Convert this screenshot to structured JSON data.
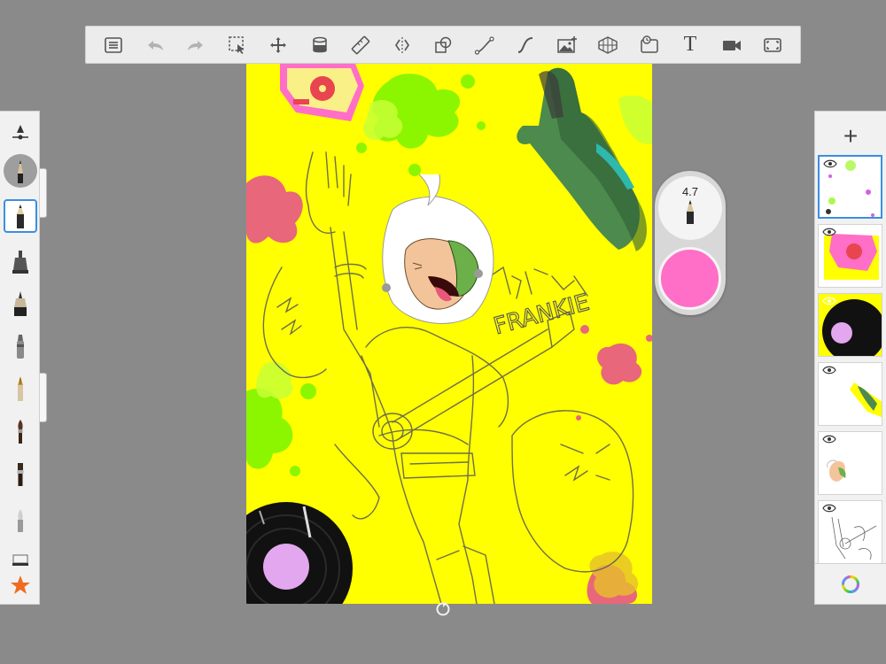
{
  "toolbar": {
    "items": [
      {
        "name": "menu-icon"
      },
      {
        "name": "undo-icon",
        "disabled": true
      },
      {
        "name": "redo-icon",
        "disabled": true
      },
      {
        "name": "selection-icon"
      },
      {
        "name": "transform-icon"
      },
      {
        "name": "fill-icon"
      },
      {
        "name": "ruler-icon"
      },
      {
        "name": "symmetry-icon"
      },
      {
        "name": "shapes-icon"
      },
      {
        "name": "curve-icon"
      },
      {
        "name": "stroke-icon"
      },
      {
        "name": "image-import-icon"
      },
      {
        "name": "perspective-icon"
      },
      {
        "name": "timelapse-icon"
      },
      {
        "name": "text-icon",
        "label": "T"
      },
      {
        "name": "video-icon"
      },
      {
        "name": "fullscreen-icon"
      }
    ]
  },
  "brushes": [
    "pencil",
    "airbrush",
    "ink-pen",
    "marker",
    "fountain-pen",
    "paintbrush",
    "chisel-brush",
    "smudge",
    "eraser",
    "favorites-star"
  ],
  "brush_puck": {
    "size_value": "4.7",
    "current_color": "#ff6ec7"
  },
  "layers": {
    "add_label": "+",
    "count": 6,
    "selected_index": 0
  },
  "canvas": {
    "background_color": "#ffff00",
    "text_on_canvas": "FRANKIE"
  }
}
